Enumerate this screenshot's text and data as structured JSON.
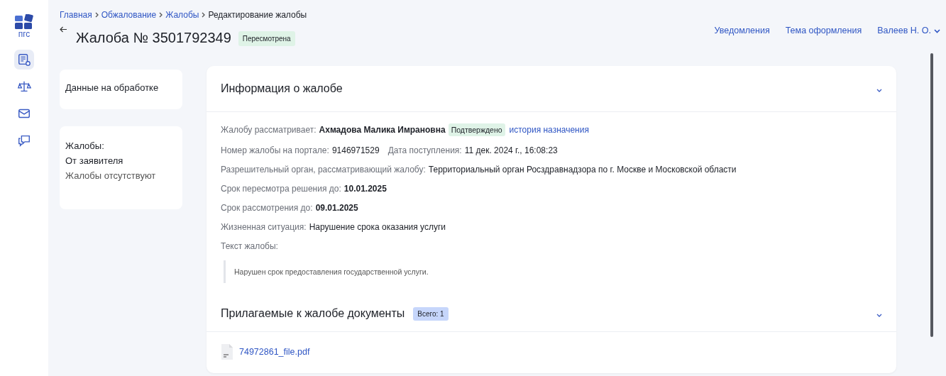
{
  "logo": {
    "text": "пгс"
  },
  "nav": [
    {
      "kind": "list",
      "selected": true
    },
    {
      "kind": "scales",
      "selected": false
    },
    {
      "kind": "mail",
      "selected": false
    },
    {
      "kind": "chat",
      "selected": false
    }
  ],
  "breadcrumbs": [
    {
      "label": "Главная",
      "kind": "link"
    },
    {
      "label": "Обжалование",
      "kind": "link"
    },
    {
      "label": "Жалобы",
      "kind": "link"
    },
    {
      "label": "Редактирование жалобы",
      "kind": "current"
    }
  ],
  "title": "Жалоба № 3501792349",
  "status": "Пересмотрена",
  "top_links": [
    {
      "label": "Уведомления",
      "kind": "link"
    },
    {
      "label": "Тема оформления",
      "kind": "link"
    },
    {
      "label": "Валеев Н. О.",
      "kind": "menu"
    }
  ],
  "side_cards": [
    {
      "lines": [
        {
          "text": "Данные на обработке",
          "kind": "title"
        }
      ]
    },
    {
      "lines": [
        {
          "text": "Жалобы:",
          "kind": "title"
        },
        {
          "text": "От заявителя",
          "kind": "sub"
        },
        {
          "text": "Жалобы отсутствуют",
          "kind": "plain"
        }
      ]
    }
  ],
  "sections": [
    {
      "title": "Информация о жалобе",
      "rows": [
        [
          {
            "kind": "label",
            "text": "Жалобу рассматривает:"
          },
          {
            "kind": "strong",
            "text": "Ахмадова Малика Имрановна"
          },
          {
            "kind": "badge",
            "text": "Подтверждено"
          },
          {
            "kind": "link",
            "text": "история назначения"
          }
        ],
        [
          {
            "kind": "label",
            "text": "Номер жалобы на портале:"
          },
          {
            "kind": "value",
            "text": "9146971529"
          },
          {
            "kind": "label",
            "text": "Дата поступления:"
          },
          {
            "kind": "value",
            "text": "11 дек. 2024 г., 16:08:23"
          }
        ],
        [
          {
            "kind": "label",
            "text": "Разрешительный орган, рассматривающий жалобу:"
          },
          {
            "kind": "value",
            "text": "Территориальный орган Росздравнадзора по г. Москве и Московской области"
          }
        ],
        [
          {
            "kind": "label",
            "text": "Срок пересмотра решения до:"
          },
          {
            "kind": "strong",
            "text": "10.01.2025"
          }
        ],
        [
          {
            "kind": "label",
            "text": "Срок рассмотрения до:"
          },
          {
            "kind": "strong",
            "text": "09.01.2025"
          }
        ],
        [
          {
            "kind": "label",
            "text": "Жизненная ситуация:"
          },
          {
            "kind": "value",
            "text": "Нарушение срока оказания услуги"
          }
        ],
        [
          {
            "kind": "label",
            "text": "Текст жалобы:"
          }
        ],
        [
          {
            "kind": "quote",
            "text": "Нарушен срок предоставления государственной услуги."
          }
        ]
      ]
    },
    {
      "title": "Прилагаемые к жалобе документы",
      "count": "Всего: 1",
      "files": [
        "74972861_file.pdf"
      ]
    }
  ]
}
